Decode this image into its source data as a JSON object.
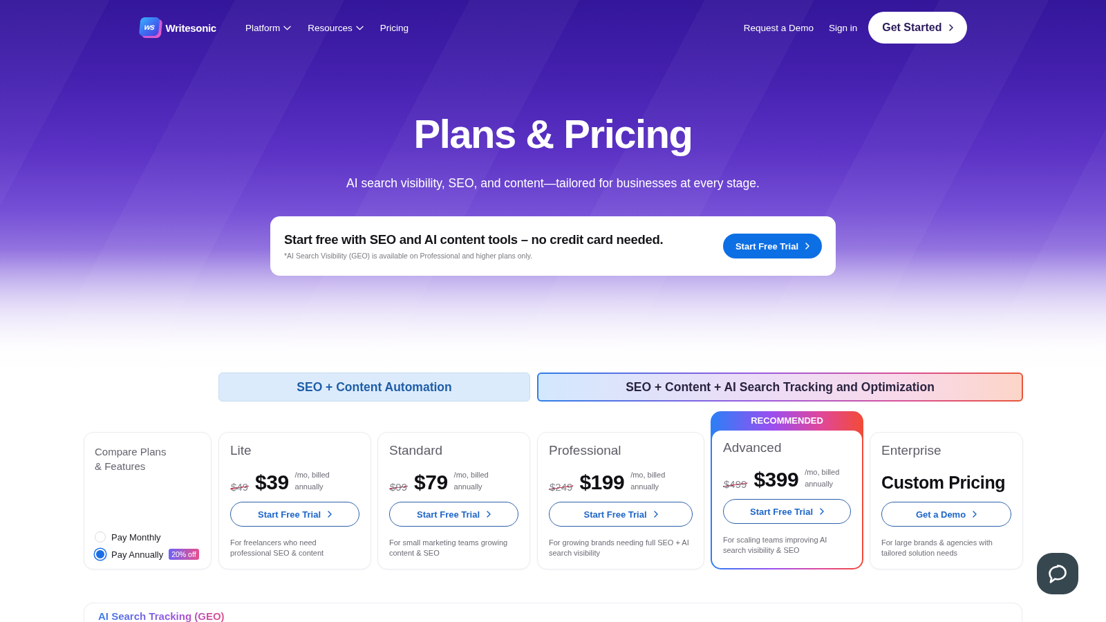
{
  "header": {
    "logo": {
      "mark": "ws",
      "name": "Writesonic"
    },
    "nav": [
      {
        "label": "Platform",
        "has_menu": true
      },
      {
        "label": "Resources",
        "has_menu": true
      },
      {
        "label": "Pricing",
        "has_menu": false
      }
    ],
    "actions": [
      {
        "label": "Request a Demo",
        "kind": "link"
      },
      {
        "label": "Sign in",
        "kind": "link"
      },
      {
        "label": "Get Started",
        "kind": "button"
      }
    ]
  },
  "hero": {
    "title": "Plans & Pricing",
    "subtitle": "AI search visibility, SEO, and content—tailored for businesses at every stage."
  },
  "banner": {
    "heading": "Start free with SEO and AI content tools – no credit card needed.",
    "note": "*AI Search Visibility (GEO) is available on Professional and higher plans only.",
    "button": "Start Free Trial"
  },
  "compare": {
    "title_lines": [
      "Compare Plans",
      "& Features"
    ],
    "billing": [
      {
        "label": "Pay Monthly",
        "selected": false
      },
      {
        "label": "Pay Annually",
        "selected": true,
        "badge": "20% off"
      }
    ]
  },
  "plan_groups": [
    {
      "label": "SEO + Content Automation",
      "kind": "core",
      "plans": [
        {
          "kind": "fixed",
          "name": "Lite",
          "old_price": "$49",
          "price": "$39",
          "price_note": "/mo, billed annually",
          "button": "Start Free Trial",
          "description": "For freelancers who need professional SEO & content"
        },
        {
          "kind": "fixed",
          "name": "Standard",
          "old_price": "$99",
          "price": "$79",
          "price_note": "/mo, billed annually",
          "button": "Start Free Trial",
          "description": "For small marketing teams growing content & SEO"
        }
      ]
    },
    {
      "label": "SEO + Content + AI Search Tracking and Optimization",
      "kind": "premium",
      "plans": [
        {
          "kind": "fixed",
          "name": "Professional",
          "old_price": "$249",
          "price": "$199",
          "price_note": "/mo, billed annually",
          "button": "Start Free Trial",
          "description": "For growing brands needing full SEO + AI search visibility"
        },
        {
          "kind": "fixed",
          "name": "Advanced",
          "ribbon": "RECOMMENDED",
          "old_price": "$499",
          "price": "$399",
          "price_note": "/mo, billed annually",
          "button": "Start Free Trial",
          "description": "For scaling teams improving AI search visibility & SEO"
        },
        {
          "kind": "custom",
          "name": "Enterprise",
          "price": "Custom Pricing",
          "button": "Get a Demo",
          "description": "For large brands & agencies with tailored solution needs"
        }
      ]
    }
  ],
  "next_section": {
    "title": "AI Search Tracking (GEO)"
  }
}
